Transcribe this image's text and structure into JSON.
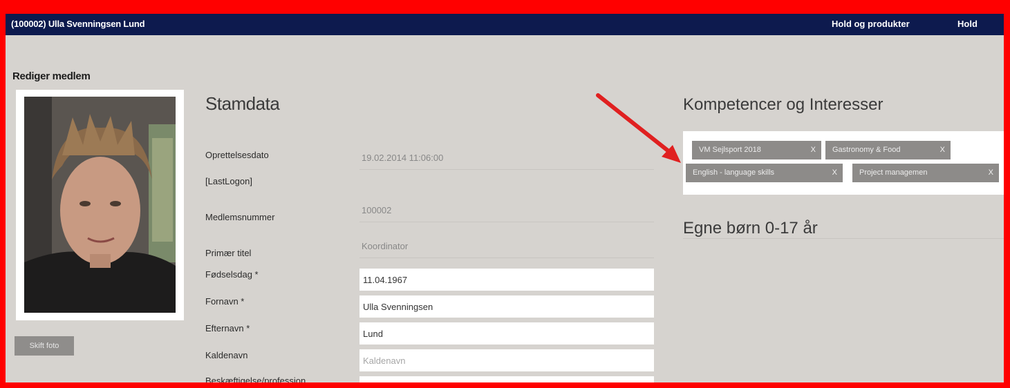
{
  "topbar": {
    "member": "(100002) Ulla Svenningsen Lund",
    "nav": [
      "Hold og produkter",
      "Hold"
    ]
  },
  "page_title": "Rediger medlem",
  "change_photo_button": "Skift foto",
  "stamdata": {
    "title": "Stamdata",
    "fields": {
      "oprettelsesdato_label": "Oprettelsesdato",
      "oprettelsesdato_value": "19.02.2014 11:06:00",
      "lastlogon_label": "[LastLogon]",
      "medlemsnummer_label": "Medlemsnummer",
      "medlemsnummer_value": "100002",
      "primaer_titel_label": "Primær titel",
      "primaer_titel_value": "Koordinator",
      "fodselsdag_label": "Fødselsdag *",
      "fodselsdag_value": "11.04.1967",
      "fornavn_label": "Fornavn *",
      "fornavn_value": "Ulla Svenningsen",
      "efternavn_label": "Efternavn *",
      "efternavn_value": "Lund",
      "kaldenavn_label": "Kaldenavn",
      "kaldenavn_placeholder": "Kaldenavn",
      "beskaeftigelse_label": "Beskæftigelse/profession"
    }
  },
  "competences": {
    "title": "Kompetencer og Interesser",
    "tags": [
      "VM Sejlsport 2018",
      "Gastronomy & Food",
      "English - language skills",
      "Project managemen"
    ],
    "remove_glyph": "X"
  },
  "children": {
    "title": "Egne børn 0-17 år"
  }
}
